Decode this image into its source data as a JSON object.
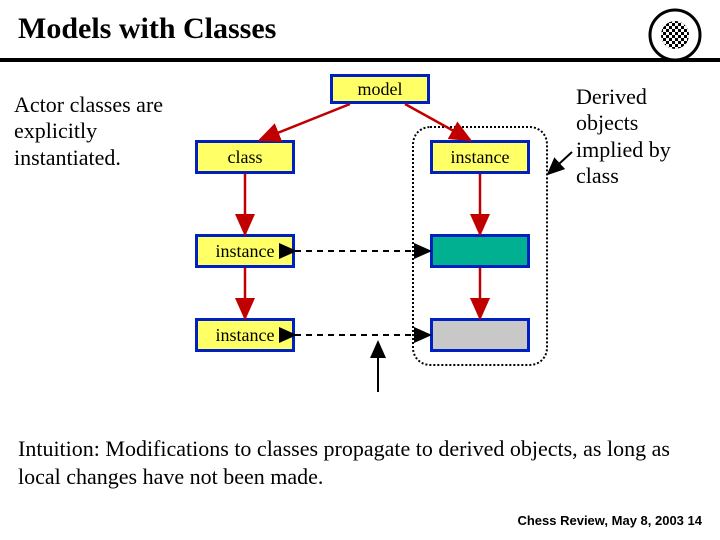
{
  "title": "Models with Classes",
  "left_note": "Actor classes are explicitly instantiated.",
  "right_note": "Derived objects implied by class",
  "boxes": {
    "model": "model",
    "class": "class",
    "instance_r": "instance",
    "instance_l1": "instance",
    "instance_l2": "instance"
  },
  "intuition": "Intuition: Modifications to classes propagate to derived objects, as long as local changes have not been made.",
  "footer": "Chess Review, May 8, 2003  14"
}
